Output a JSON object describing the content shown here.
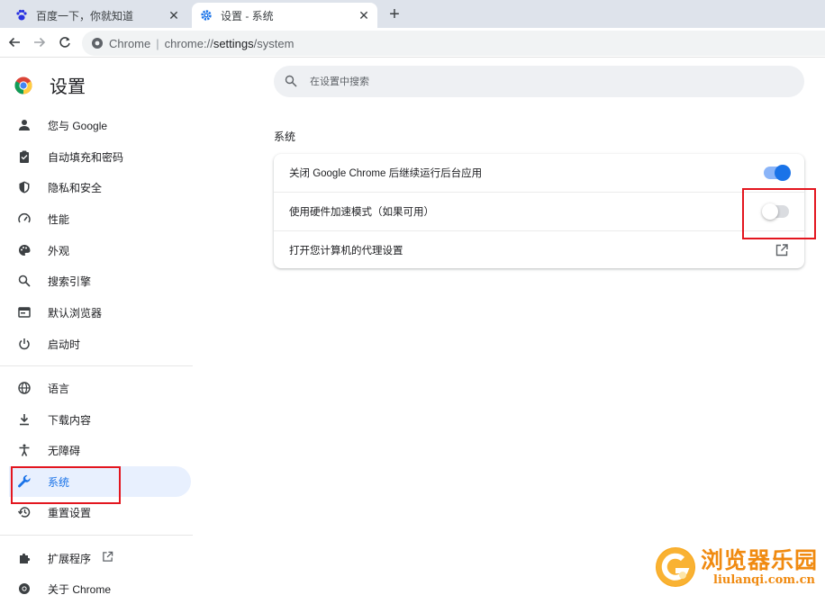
{
  "tabs": [
    {
      "title": "百度一下，你就知道",
      "icon": "baidu-paw-icon",
      "active": false
    },
    {
      "title": "设置 - 系统",
      "icon": "settings-gear-icon",
      "active": true
    }
  ],
  "omnibox": {
    "host": "Chrome",
    "url_prefix": "chrome://",
    "url_path": "settings",
    "url_suffix": "/system"
  },
  "sidebar": {
    "title": "设置",
    "items": [
      {
        "label": "您与 Google",
        "icon": "person-icon"
      },
      {
        "label": "自动填充和密码",
        "icon": "clipboard-icon"
      },
      {
        "label": "隐私和安全",
        "icon": "shield-icon"
      },
      {
        "label": "性能",
        "icon": "speedometer-icon"
      },
      {
        "label": "外观",
        "icon": "palette-icon"
      },
      {
        "label": "搜索引擎",
        "icon": "search-icon"
      },
      {
        "label": "默认浏览器",
        "icon": "browser-window-icon"
      },
      {
        "label": "启动时",
        "icon": "power-icon"
      },
      {
        "label": "语言",
        "icon": "globe-icon"
      },
      {
        "label": "下载内容",
        "icon": "download-icon"
      },
      {
        "label": "无障碍",
        "icon": "accessibility-icon"
      },
      {
        "label": "系统",
        "icon": "wrench-icon"
      },
      {
        "label": "重置设置",
        "icon": "history-icon"
      },
      {
        "label": "扩展程序",
        "icon": "puzzle-icon"
      },
      {
        "label": "关于 Chrome",
        "icon": "chrome-logo-icon"
      }
    ]
  },
  "search": {
    "placeholder": "在设置中搜索"
  },
  "system": {
    "section_title": "系统",
    "rows": [
      {
        "label": "关闭 Google Chrome 后继续运行后台应用",
        "control": "toggle",
        "on": true
      },
      {
        "label": "使用硬件加速模式（如果可用）",
        "control": "toggle",
        "on": false
      },
      {
        "label": "打开您计算机的代理设置",
        "control": "external-link"
      }
    ]
  },
  "watermark": {
    "cn": "浏览器乐园",
    "en": "liulanqi.com.cn"
  },
  "colors": {
    "accent": "#1a73e8",
    "highlight": "#e3161f",
    "tabstrip": "#dee3eb",
    "watermark": "#f08a10"
  }
}
